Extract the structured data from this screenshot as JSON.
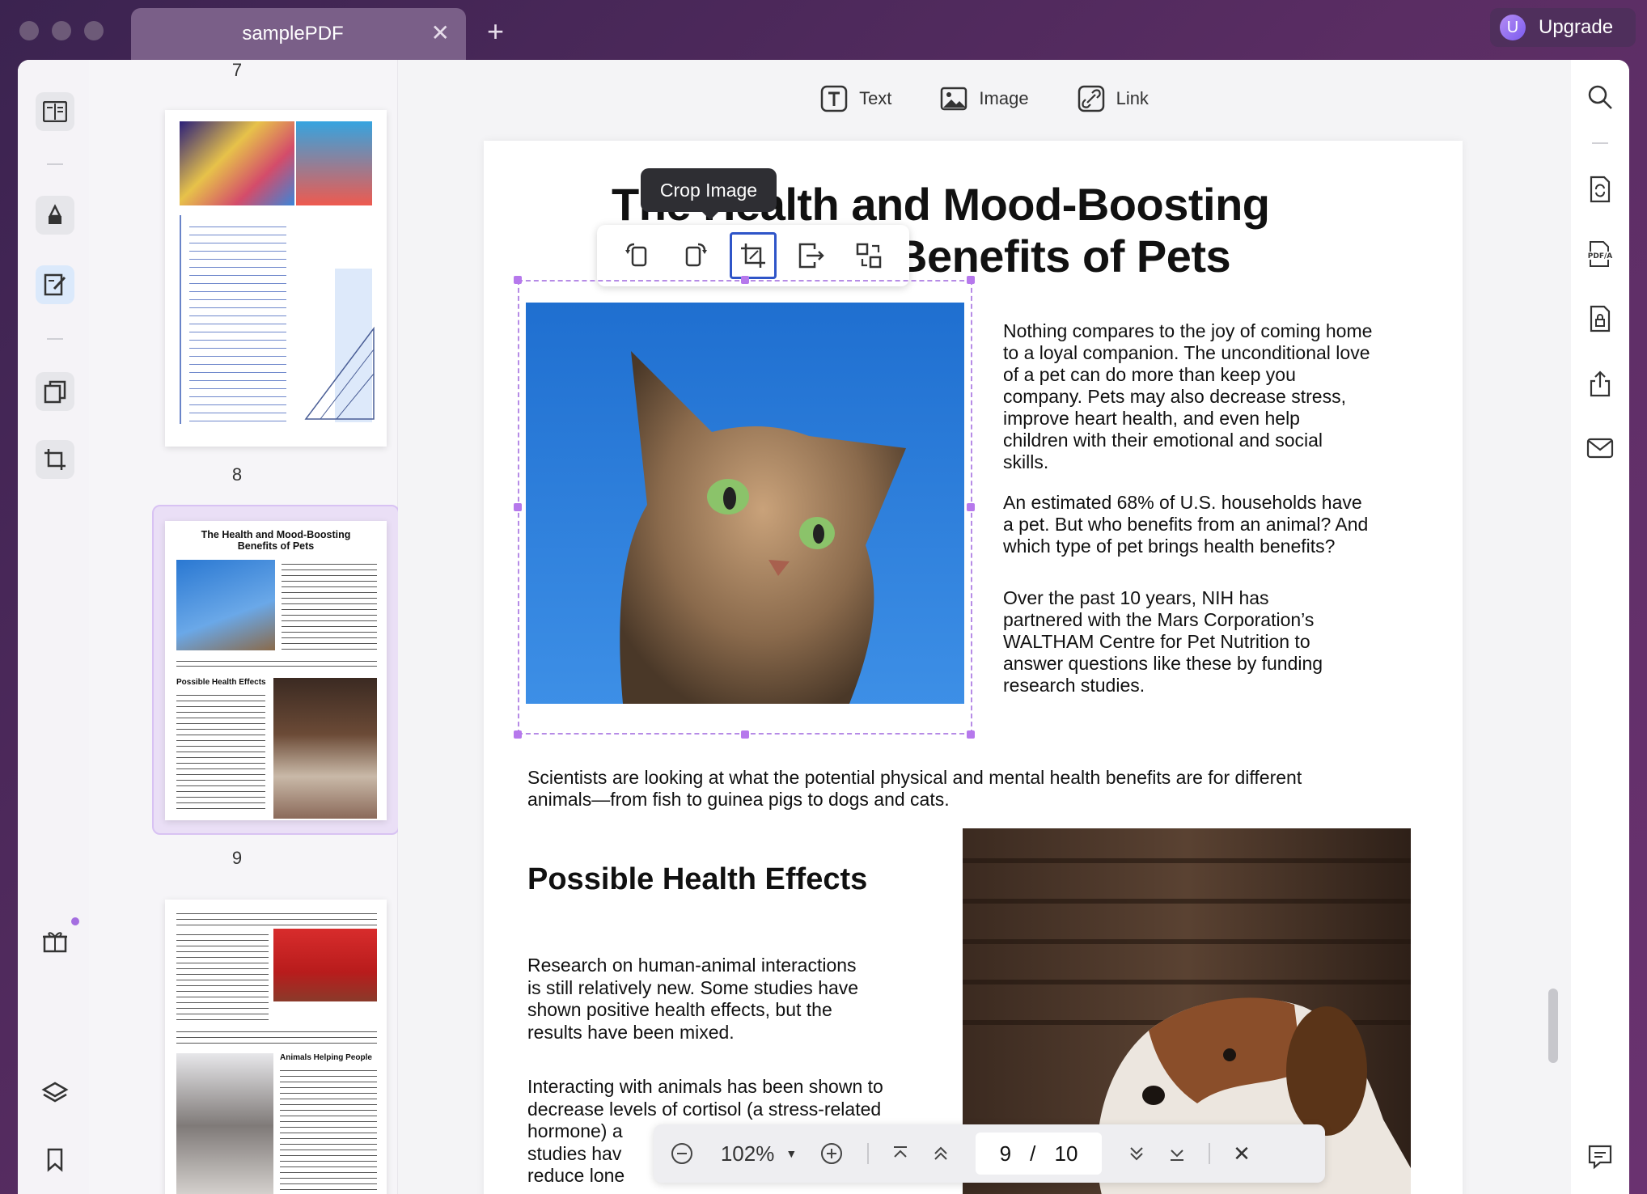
{
  "tab": {
    "title": "samplePDF"
  },
  "upgrade": {
    "label": "Upgrade",
    "avatar_letter": "U"
  },
  "edit_toolbar": {
    "text": "Text",
    "image": "Image",
    "link": "Link"
  },
  "tooltip": {
    "crop": "Crop Image"
  },
  "thumbnails": {
    "page7": "7",
    "page8": "8",
    "page9": "9"
  },
  "thumb9": {
    "title_line1": "The Health and Mood-Boosting",
    "title_line2": "Benefits of Pets",
    "section": "Possible Health Effects"
  },
  "thumb10": {
    "section": "Animals Helping People"
  },
  "document": {
    "title_line1": "The Health and Mood-Boosting",
    "title_line2": "Benefits of Pets",
    "p1": [
      "Nothing compares to the joy of coming home",
      "to a loyal companion. The unconditional love",
      "of a pet can do more than keep you",
      "company. Pets may also decrease stress,",
      "improve heart health,  and  even  help",
      "children  with  their emotional and social",
      "skills."
    ],
    "p2": [
      "An estimated 68% of U.S. households have",
      "a pet. But who benefits from an animal? And",
      "which type of pet brings health benefits?"
    ],
    "p3": [
      "Over  the  past  10  years,  NIH  has",
      "partnered with the Mars Corporation’s",
      "WALTHAM Centre for  Pet  Nutrition  to",
      "answer  questions  like these by funding",
      "research studies."
    ],
    "p4": [
      "Scientists are looking at what the potential physical and mental health benefits are for different",
      "animals—from fish to guinea pigs to dogs and cats."
    ],
    "section_title": "Possible Health Effects",
    "p5": [
      "Research  on  human-animal  interactions",
      "is still  relatively  new.  Some  studies  have",
      "shown  positive  health  effects,  but  the",
      "results have been mixed."
    ],
    "p6": [
      "Interacting with animals has been shown to",
      "decrease levels of cortisol (a stress-related",
      "hormone) a",
      "studies hav",
      "reduce lone"
    ]
  },
  "pagenav": {
    "zoom": "102%",
    "current": "9",
    "separator": "/",
    "total": "10"
  },
  "colors": {
    "accent": "#b678ec",
    "crop_active": "#2f55c8",
    "titlebar": "#4a2a58"
  }
}
